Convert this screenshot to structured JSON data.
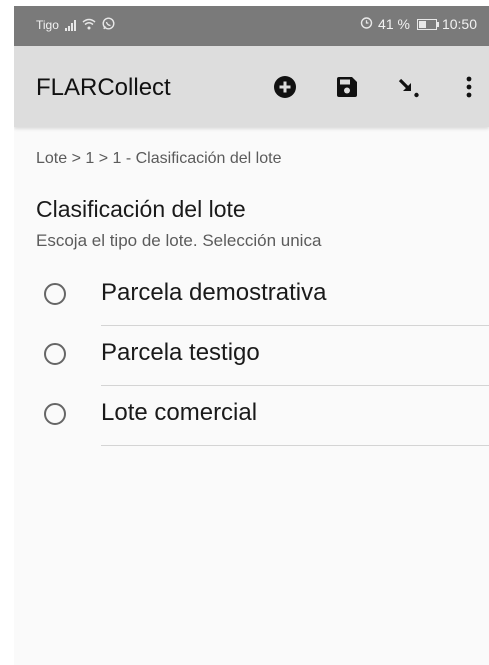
{
  "status_bar": {
    "carrier": "Tigo",
    "battery_percent": "41 %",
    "time": "10:50",
    "battery_level": 0.41,
    "icons": [
      "signal-icon",
      "wifi-icon",
      "whatsapp-icon",
      "alarm-icon",
      "battery-icon"
    ]
  },
  "app_bar": {
    "title": "FLARCollect",
    "actions": [
      "add-icon",
      "save-icon",
      "export-icon",
      "more-vert-icon"
    ]
  },
  "breadcrumb": "Lote > 1 > 1 - Clasificación del lote",
  "question": {
    "title": "Clasificación del lote",
    "hint": "Escoja el tipo de lote. Selección unica",
    "options": [
      {
        "label": "Parcela demostrativa",
        "selected": false
      },
      {
        "label": "Parcela testigo",
        "selected": false
      },
      {
        "label": "Lote comercial",
        "selected": false
      }
    ]
  },
  "colors": {
    "status_bar": "#7a7a7a",
    "app_bar": "#dddddd",
    "background": "#fafafa"
  }
}
